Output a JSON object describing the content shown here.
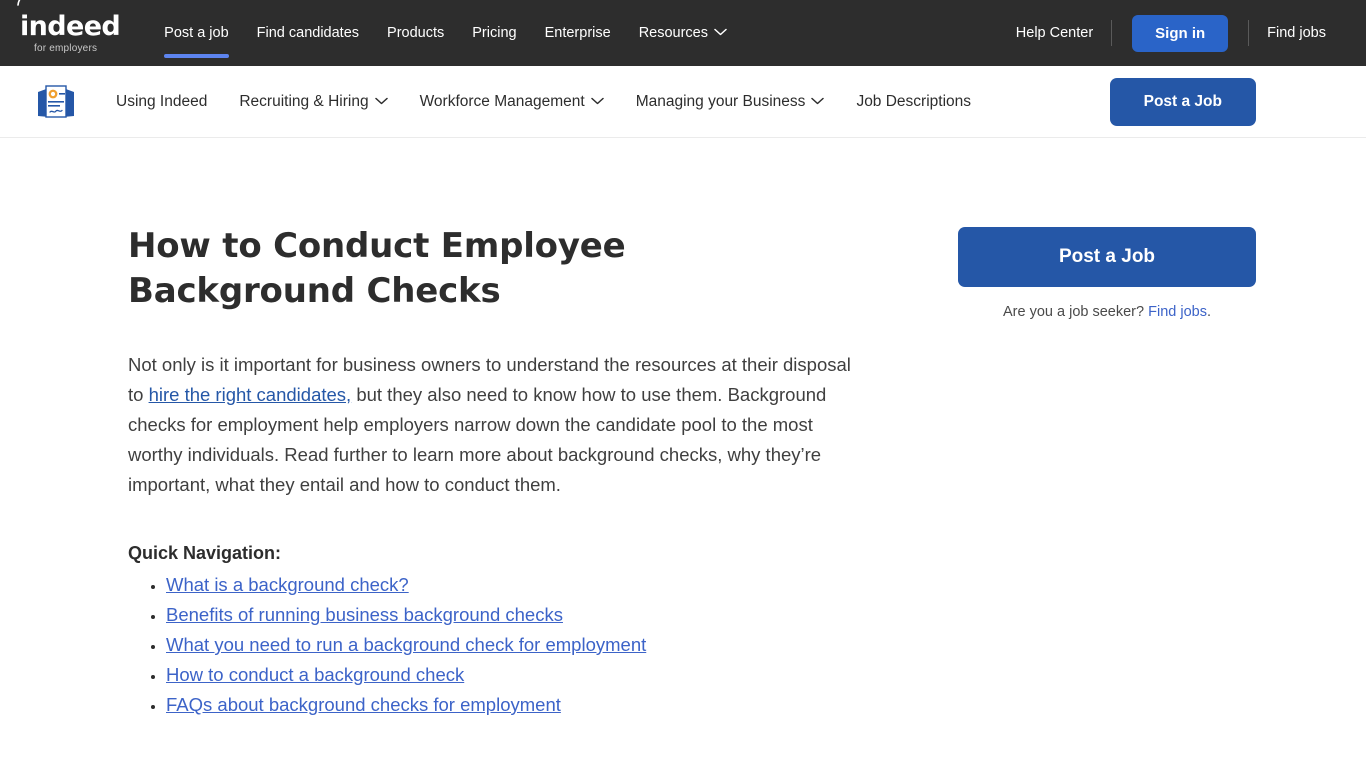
{
  "brand": {
    "logo_word": "indeed",
    "logo_tagline": "for employers",
    "accent_blue": "#2557a7",
    "signin_blue": "#2a64c8",
    "active_tab_blue": "#5d84ef",
    "link_blue": "#3c63c8",
    "topnav_bg": "#2d2d2d"
  },
  "topnav": {
    "links": [
      {
        "label": "Post a job",
        "active": true
      },
      {
        "label": "Find candidates",
        "active": false
      },
      {
        "label": "Products",
        "active": false
      },
      {
        "label": "Pricing",
        "active": false
      },
      {
        "label": "Enterprise",
        "active": false
      },
      {
        "label": "Resources",
        "active": false,
        "caret": true
      }
    ],
    "help_center": "Help Center",
    "sign_in": "Sign in",
    "find_jobs": "Find jobs"
  },
  "subnav": {
    "icon": "certificate-document-icon",
    "links": [
      {
        "label": "Using Indeed",
        "caret": false
      },
      {
        "label": "Recruiting & Hiring",
        "caret": true
      },
      {
        "label": "Workforce Management",
        "caret": true
      },
      {
        "label": "Managing your Business",
        "caret": true
      },
      {
        "label": "Job Descriptions",
        "caret": false
      }
    ],
    "post_a_job": "Post a Job"
  },
  "article": {
    "title": "How to Conduct Employee Background Checks",
    "intro_part1": "Not only is it important for business owners to understand the resources at their disposal to ",
    "intro_link": "hire the right candidates,",
    "intro_part2": " but they also need to know how to use them. Background checks for employment help employers narrow down the candidate pool to the most worthy individuals. Read further to learn more about background checks, why they’re important, what they entail and how to conduct them.",
    "quick_nav_title": "Quick Navigation:",
    "quick_nav_items": [
      "What is a background check?",
      "Benefits of running business background checks",
      "What you need to run a background check for employment",
      "How to conduct a background check",
      "FAQs about background checks for employment"
    ]
  },
  "sidebar": {
    "post_a_job": "Post a Job",
    "seeker_prompt": "Are you a job seeker? ",
    "seeker_link": "Find jobs",
    "seeker_period": "."
  }
}
